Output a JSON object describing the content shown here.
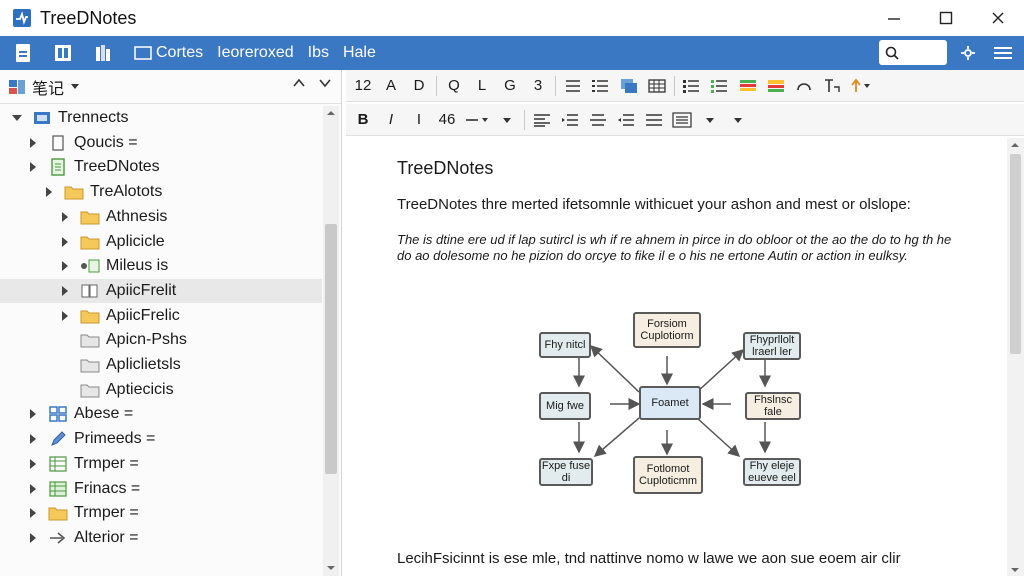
{
  "window": {
    "title": "TreeDNotes"
  },
  "menubar": {
    "items": [
      "Cortes",
      "Ieoreroxed",
      "Ibs",
      "Hale"
    ],
    "search_placeholder": ""
  },
  "sidebar": {
    "header_label": "笔记",
    "tree": [
      {
        "label": "Trennects",
        "level": 0,
        "expanded": true,
        "icon": "notebook-icon"
      },
      {
        "label": "Qoucis =",
        "level": 1,
        "icon": "document-icon"
      },
      {
        "label": "TreeDNotes",
        "level": 1,
        "icon": "green-document-icon"
      },
      {
        "label": "TreAlotots",
        "level": 2,
        "icon": "folder-icon"
      },
      {
        "label": "Athnesis",
        "level": 3,
        "icon": "folder-icon"
      },
      {
        "label": "Aplicicle",
        "level": 3,
        "icon": "folder-icon"
      },
      {
        "label": "Mileus is",
        "level": 3,
        "icon": "green-link-icon"
      },
      {
        "label": "ApiicFrelit",
        "level": 3,
        "icon": "book-icon",
        "selected": true
      },
      {
        "label": "ApiicFrelic",
        "level": 3,
        "icon": "folder-icon"
      },
      {
        "label": "Apicn-Pshs",
        "level": 3,
        "icon": "gray-folder-icon"
      },
      {
        "label": "Apliclietsls",
        "level": 3,
        "icon": "gray-folder-icon"
      },
      {
        "label": "Aptiecicis",
        "level": 3,
        "icon": "gray-folder-icon"
      },
      {
        "label": "Abese =",
        "level": 1,
        "icon": "grid-icon"
      },
      {
        "label": "Primeeds =",
        "level": 1,
        "icon": "pen-icon"
      },
      {
        "label": "Trmper =",
        "level": 1,
        "icon": "table-icon"
      },
      {
        "label": "Frinacs =",
        "level": 1,
        "icon": "green-table-icon"
      },
      {
        "label": "Trmper =",
        "level": 1,
        "icon": "folder-icon"
      },
      {
        "label": "Alterior =",
        "level": 1,
        "icon": "arrow-icon"
      }
    ]
  },
  "toolbar1": [
    "12",
    "A",
    "D",
    "Q",
    "L",
    "G",
    "3"
  ],
  "toolbar2": [
    "B",
    "I",
    "I",
    "46"
  ],
  "document": {
    "title": "TreeDNotes",
    "para1": "TreeDNotes thre merted ifetsomnle withicuet your ashon and mest or olslope:",
    "para2": "The is dtine ere ud if lap sutircl is wh if re ahnem in pirce in do obloor ot the ao the do to hg th he do ao dolesome no he pizion do orcye to fike il e o his ne ertone Autin or action in eulksy.",
    "para3": "LecihFsicinnt is ese mle, tnd nattinve nomo w lawe we aon sue eoem air clir"
  },
  "diagram": {
    "center": "Foamet",
    "top": "Forsiom Cuplotiorm",
    "bottom": "Fotlomot Cuploticmm",
    "left_top": "Fhy nitcl",
    "left_mid": "Mig fwe",
    "left_bot": "Fxpe fuse di",
    "right_top": "Fhyprllolt lraerl ler",
    "right_mid": "Fhslnsc fale",
    "right_bot": "Fhy eleje eueve eel"
  }
}
